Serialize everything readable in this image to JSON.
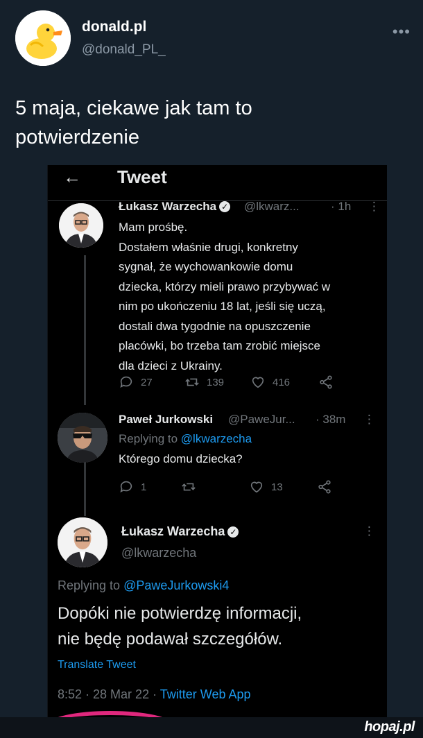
{
  "outer_tweet": {
    "display_name": "donald.pl",
    "handle": "@donald_PL_",
    "more_icon": "ellipsis-icon",
    "text_line1": "5 maja, ciekawe jak tam to",
    "text_line2": "potwierdzenie"
  },
  "screenshot": {
    "topbar_title": "Tweet",
    "back_icon": "back-arrow-icon",
    "tweets": [
      {
        "name": "Łukasz Warzecha",
        "verified": true,
        "handle": "@lkwarz...",
        "time": "· 1h",
        "lines": [
          "Mam prośbę.",
          "Dostałem właśnie drugi, konkretny",
          "sygnał, że wychowankowie domu",
          "dziecka, którzy mieli prawo przybywać w",
          "nim po ukończeniu 18 lat, jeśli się uczą,",
          "dostali dwa tygodnie na opuszczenie",
          "placówki, bo trzeba tam zrobić miejsce",
          "dla dzieci z Ukrainy."
        ],
        "replies": "27",
        "retweets": "139",
        "likes": "416"
      },
      {
        "name": "Paweł Jurkowski",
        "handle": "@PaweJur...",
        "time": "· 38m",
        "replying_prefix": "Replying to",
        "replying_to": "@lkwarzecha",
        "text": "Którego domu dziecka?",
        "replies": "1",
        "retweets": "",
        "likes": "13"
      }
    ],
    "main_tweet": {
      "name": "Łukasz Warzecha",
      "verified": true,
      "handle": "@lkwarzecha",
      "replying_prefix": "Replying to",
      "replying_to": "@PaweJurkowski4",
      "text_line1": "Dopóki nie potwierdzę informacji,",
      "text_line2": "nie będę podawał szczegółów.",
      "translate_label": "Translate Tweet",
      "timestamp": "8:52 · 28 Mar 22 ·",
      "source_app": "Twitter Web App"
    }
  },
  "watermark": "hopaj.pl",
  "colors": {
    "background": "#15202b",
    "link_blue": "#1d9bf0",
    "muted": "#71767b",
    "accent_pink": "#e0287e"
  }
}
